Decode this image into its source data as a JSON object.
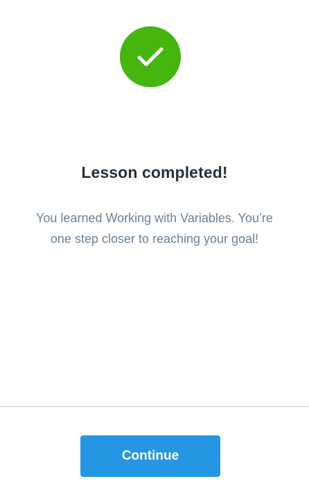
{
  "colors": {
    "success": "#46b60f",
    "title": "#25313c",
    "message": "#6b7f97",
    "divider": "#c9d1d9",
    "primary_button": "#2596e3",
    "button_text": "#ffffff"
  },
  "status": {
    "icon": "check-icon",
    "title": "Lesson completed!",
    "message_line_1": "You learned Working with Variables. You’re",
    "message_line_2": "one step closer to reaching your goal!"
  },
  "actions": {
    "continue_label": "Continue"
  }
}
